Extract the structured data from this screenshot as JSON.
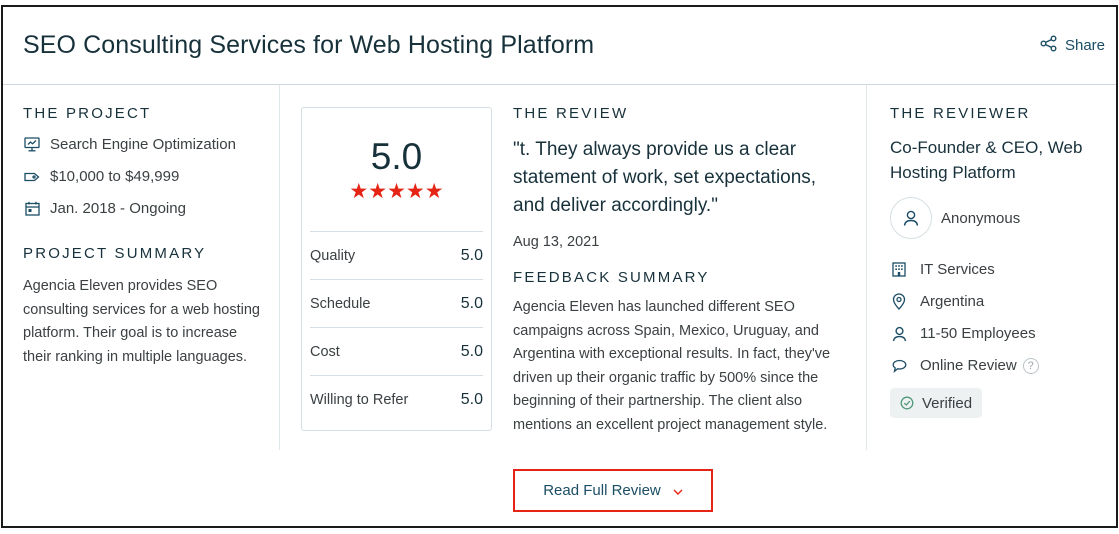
{
  "header": {
    "title": "SEO Consulting Services for Web Hosting Platform",
    "share_label": "Share"
  },
  "project": {
    "section_label": "THE PROJECT",
    "details": [
      {
        "icon": "monitor-icon",
        "text": "Search Engine Optimization"
      },
      {
        "icon": "tag-icon",
        "text": "$10,000 to $49,999"
      },
      {
        "icon": "calendar-icon",
        "text": "Jan. 2018 - Ongoing"
      }
    ],
    "summary_label": "PROJECT SUMMARY",
    "summary_text": "Agencia Eleven provides SEO consulting services for a web hosting platform. Their goal is to increase their ranking in multiple languages."
  },
  "rating": {
    "overall": "5.0",
    "stars": "★★★★★",
    "star_fraction": 1.0,
    "rows": [
      {
        "label": "Quality",
        "value": "5.0"
      },
      {
        "label": "Schedule",
        "value": "5.0"
      },
      {
        "label": "Cost",
        "value": "5.0"
      },
      {
        "label": "Willing to Refer",
        "value": "5.0"
      }
    ]
  },
  "review": {
    "section_label": "THE REVIEW",
    "quote": "\"t. They always provide us a clear statement of work, set expectations, and deliver accordingly.\"",
    "date": "Aug 13, 2021",
    "feedback_label": "FEEDBACK SUMMARY",
    "feedback_text": "Agencia Eleven has launched different SEO campaigns across Spain, Mexico, Uruguay, and Argentina with exceptional results. In fact, they've driven up their organic traffic by 500% since the beginning of their partnership. The client also mentions an excellent project management style."
  },
  "reviewer": {
    "section_label": "THE REVIEWER",
    "title": "Co-Founder & CEO, Web Hosting Platform",
    "name": "Anonymous",
    "details": [
      {
        "icon": "building-icon",
        "text": "IT Services"
      },
      {
        "icon": "location-pin-icon",
        "text": "Argentina"
      },
      {
        "icon": "person-icon",
        "text": "11-50 Employees"
      },
      {
        "icon": "chat-bubble-icon",
        "text": "Online Review",
        "help": "?"
      }
    ],
    "verified_label": "Verified"
  },
  "footer": {
    "read_more_label": "Read Full Review"
  },
  "colors": {
    "accent_red": "#e62415",
    "title_navy": "#17313b",
    "link_blue": "#1b4d65",
    "body_text": "#3b4043",
    "divider": "#d6dfe3"
  }
}
